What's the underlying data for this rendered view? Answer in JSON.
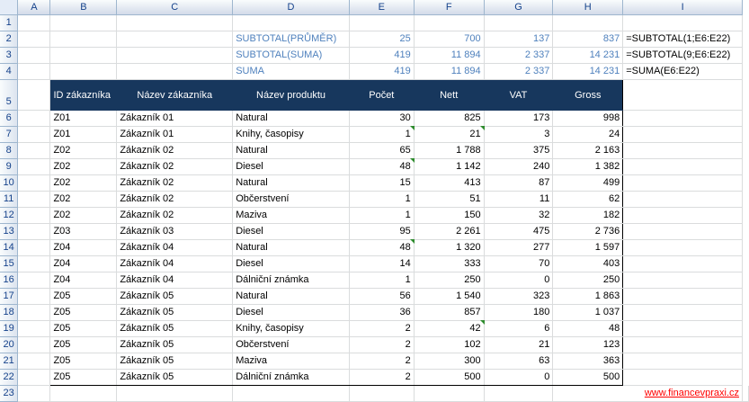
{
  "columns": [
    "A",
    "B",
    "C",
    "D",
    "E",
    "F",
    "G",
    "H",
    "I"
  ],
  "rows": [
    "1",
    "2",
    "3",
    "4",
    "5",
    "6",
    "7",
    "8",
    "9",
    "10",
    "11",
    "12",
    "13",
    "14",
    "15",
    "16",
    "17",
    "18",
    "19",
    "20",
    "21",
    "22",
    "23"
  ],
  "summary": [
    {
      "label": "SUBTOTAL(PRŮMĚR)",
      "e": "25",
      "f": "700",
      "g": "137",
      "h": "837",
      "formula": "=SUBTOTAL(1;E6:E22)"
    },
    {
      "label": "SUBTOTAL(SUMA)",
      "e": "419",
      "f": "11 894",
      "g": "2 337",
      "h": "14 231",
      "formula": "=SUBTOTAL(9;E6:E22)"
    },
    {
      "label": "SUMA",
      "e": "419",
      "f": "11 894",
      "g": "2 337",
      "h": "14 231",
      "formula": "=SUMA(E6:E22)"
    }
  ],
  "headers": [
    "ID zákazníka",
    "Název zákazníka",
    "Název produktu",
    "Počet",
    "Nett",
    "VAT",
    "Gross"
  ],
  "data": [
    [
      "Z01",
      "Zákazník 01",
      "Natural",
      "30",
      "825",
      "173",
      "998"
    ],
    [
      "Z01",
      "Zákazník 01",
      "Knihy, časopisy",
      "1",
      "21",
      "3",
      "24"
    ],
    [
      "Z02",
      "Zákazník 02",
      "Natural",
      "65",
      "1 788",
      "375",
      "2 163"
    ],
    [
      "Z02",
      "Zákazník 02",
      "Diesel",
      "48",
      "1 142",
      "240",
      "1 382"
    ],
    [
      "Z02",
      "Zákazník 02",
      "Natural",
      "15",
      "413",
      "87",
      "499"
    ],
    [
      "Z02",
      "Zákazník 02",
      "Občerstvení",
      "1",
      "51",
      "11",
      "62"
    ],
    [
      "Z02",
      "Zákazník 02",
      "Maziva",
      "1",
      "150",
      "32",
      "182"
    ],
    [
      "Z03",
      "Zákazník 03",
      "Diesel",
      "95",
      "2 261",
      "475",
      "2 736"
    ],
    [
      "Z04",
      "Zákazník 04",
      "Natural",
      "48",
      "1 320",
      "277",
      "1 597"
    ],
    [
      "Z04",
      "Zákazník 04",
      "Diesel",
      "14",
      "333",
      "70",
      "403"
    ],
    [
      "Z04",
      "Zákazník 04",
      "Dálniční známka",
      "1",
      "250",
      "0",
      "250"
    ],
    [
      "Z05",
      "Zákazník 05",
      "Natural",
      "56",
      "1 540",
      "323",
      "1 863"
    ],
    [
      "Z05",
      "Zákazník 05",
      "Diesel",
      "36",
      "857",
      "180",
      "1 037"
    ],
    [
      "Z05",
      "Zákazník 05",
      "Knihy, časopisy",
      "2",
      "42",
      "6",
      "48"
    ],
    [
      "Z05",
      "Zákazník 05",
      "Občerstvení",
      "2",
      "102",
      "21",
      "123"
    ],
    [
      "Z05",
      "Zákazník 05",
      "Maziva",
      "2",
      "300",
      "63",
      "363"
    ],
    [
      "Z05",
      "Zákazník 05",
      "Dálniční známka",
      "2",
      "500",
      "0",
      "500"
    ]
  ],
  "footer_link": "www.financevpraxi.cz"
}
